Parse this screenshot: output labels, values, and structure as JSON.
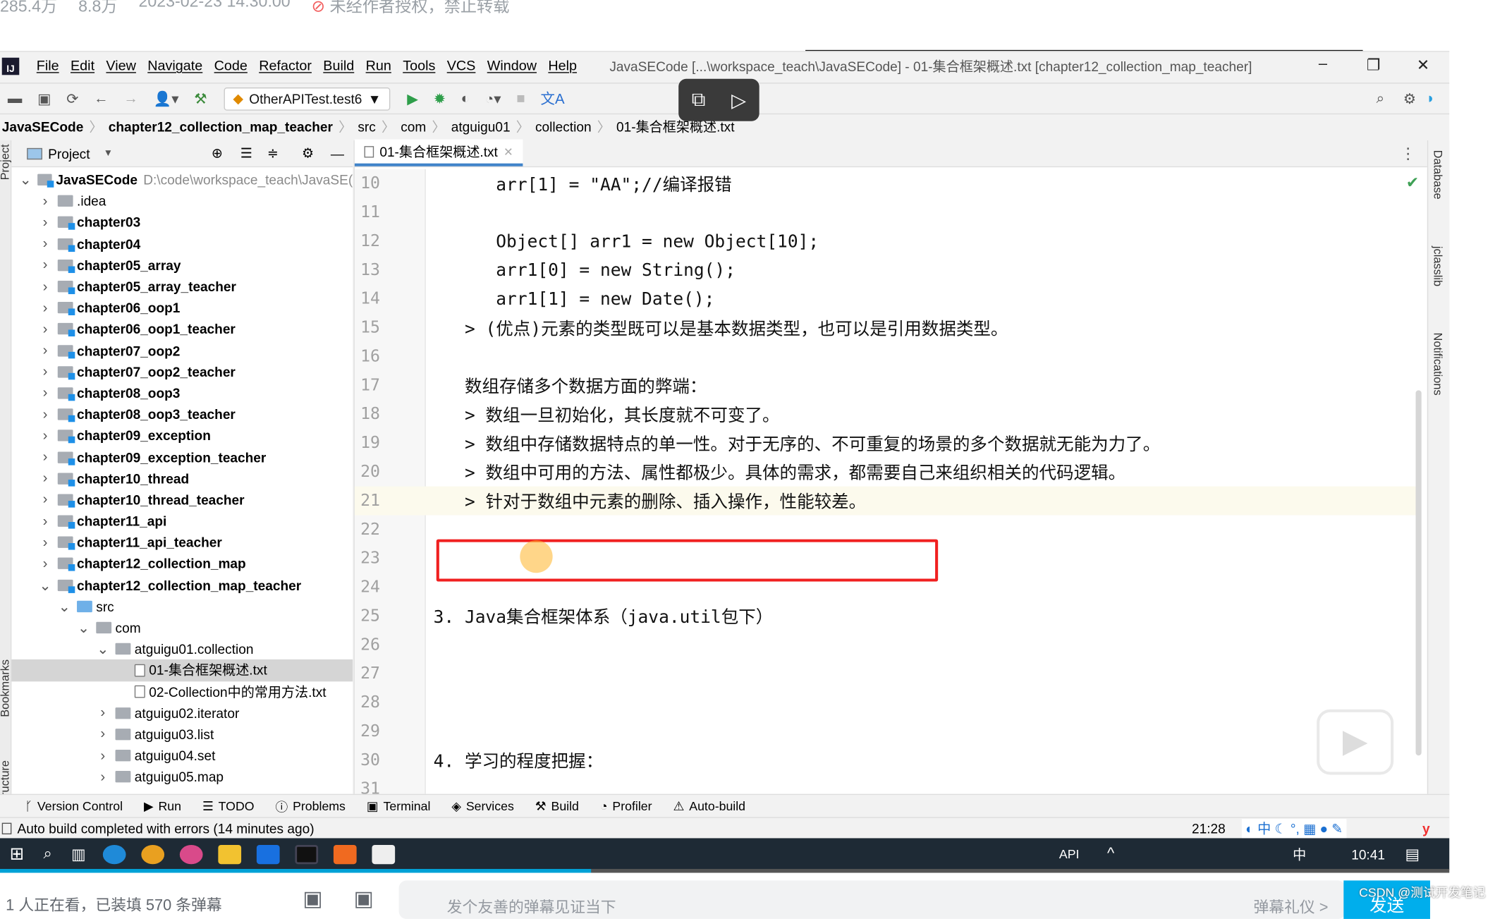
{
  "video_meta": {
    "plays": "285.4万",
    "danmaku": "8.8万",
    "datetime": "2023-02-23 14:30:00",
    "notice": "未经作者授权，禁止转载"
  },
  "menu": [
    "File",
    "Edit",
    "View",
    "Navigate",
    "Code",
    "Refactor",
    "Build",
    "Run",
    "Tools",
    "VCS",
    "Window",
    "Help"
  ],
  "window_title": "JavaSECode [...\\workspace_teach\\JavaSECode] - 01-集合框架概述.txt [chapter12_collection_map_teacher]",
  "toolbar": {
    "run_config": "OtherAPITest.test6"
  },
  "breadcrumb": [
    "JavaSECode",
    "chapter12_collection_map_teacher",
    "src",
    "com",
    "atguigu01",
    "collection",
    "01-集合框架概述.txt"
  ],
  "project_panel": {
    "title": "Project",
    "tree": [
      {
        "label": "JavaSECode",
        "path": "D:\\code\\workspace_teach\\JavaSE(",
        "level": 0,
        "type": "mod",
        "open": true,
        "bold": true
      },
      {
        "label": ".idea",
        "level": 1,
        "type": "folder",
        "open": false
      },
      {
        "label": "chapter03",
        "level": 1,
        "type": "mod",
        "open": false,
        "bold": true
      },
      {
        "label": "chapter04",
        "level": 1,
        "type": "mod",
        "open": false,
        "bold": true
      },
      {
        "label": "chapter05_array",
        "level": 1,
        "type": "mod",
        "open": false,
        "bold": true
      },
      {
        "label": "chapter05_array_teacher",
        "level": 1,
        "type": "mod",
        "open": false,
        "bold": true
      },
      {
        "label": "chapter06_oop1",
        "level": 1,
        "type": "mod",
        "open": false,
        "bold": true
      },
      {
        "label": "chapter06_oop1_teacher",
        "level": 1,
        "type": "mod",
        "open": false,
        "bold": true
      },
      {
        "label": "chapter07_oop2",
        "level": 1,
        "type": "mod",
        "open": false,
        "bold": true
      },
      {
        "label": "chapter07_oop2_teacher",
        "level": 1,
        "type": "mod",
        "open": false,
        "bold": true
      },
      {
        "label": "chapter08_oop3",
        "level": 1,
        "type": "mod",
        "open": false,
        "bold": true
      },
      {
        "label": "chapter08_oop3_teacher",
        "level": 1,
        "type": "mod",
        "open": false,
        "bold": true
      },
      {
        "label": "chapter09_exception",
        "level": 1,
        "type": "mod",
        "open": false,
        "bold": true
      },
      {
        "label": "chapter09_exception_teacher",
        "level": 1,
        "type": "mod",
        "open": false,
        "bold": true
      },
      {
        "label": "chapter10_thread",
        "level": 1,
        "type": "mod",
        "open": false,
        "bold": true
      },
      {
        "label": "chapter10_thread_teacher",
        "level": 1,
        "type": "mod",
        "open": false,
        "bold": true
      },
      {
        "label": "chapter11_api",
        "level": 1,
        "type": "mod",
        "open": false,
        "bold": true
      },
      {
        "label": "chapter11_api_teacher",
        "level": 1,
        "type": "mod",
        "open": false,
        "bold": true
      },
      {
        "label": "chapter12_collection_map",
        "level": 1,
        "type": "mod",
        "open": false,
        "bold": true
      },
      {
        "label": "chapter12_collection_map_teacher",
        "level": 1,
        "type": "mod",
        "open": true,
        "bold": true
      },
      {
        "label": "src",
        "level": 2,
        "type": "src",
        "open": true
      },
      {
        "label": "com",
        "level": 3,
        "type": "folder",
        "open": true
      },
      {
        "label": "atguigu01.collection",
        "level": 4,
        "type": "folder",
        "open": true
      },
      {
        "label": "01-集合框架概述.txt",
        "level": 5,
        "type": "file",
        "selected": true
      },
      {
        "label": "02-Collection中的常用方法.txt",
        "level": 5,
        "type": "file"
      },
      {
        "label": "atguigu02.iterator",
        "level": 4,
        "type": "folder",
        "open": false
      },
      {
        "label": "atguigu03.list",
        "level": 4,
        "type": "folder",
        "open": false
      },
      {
        "label": "atguigu04.set",
        "level": 4,
        "type": "folder",
        "open": false
      },
      {
        "label": "atguigu05.map",
        "level": 4,
        "type": "folder",
        "open": false
      }
    ]
  },
  "editor": {
    "tab": "01-集合框架概述.txt",
    "lines": [
      {
        "n": "10",
        "t": "      arr[1] = \"AA\";//编译报错"
      },
      {
        "n": "11",
        "t": ""
      },
      {
        "n": "12",
        "t": "      Object[] arr1 = new Object[10];"
      },
      {
        "n": "13",
        "t": "      arr1[0] = new String();"
      },
      {
        "n": "14",
        "t": "      arr1[1] = new Date();"
      },
      {
        "n": "15",
        "t": "   > (优点)元素的类型既可以是基本数据类型，也可以是引用数据类型。"
      },
      {
        "n": "16",
        "t": ""
      },
      {
        "n": "17",
        "t": "   数组存储多个数据方面的弊端："
      },
      {
        "n": "18",
        "t": "   > 数组一旦初始化，其长度就不可变了。"
      },
      {
        "n": "19",
        "t": "   > 数组中存储数据特点的单一性。对于无序的、不可重复的场景的多个数据就无能为力了。"
      },
      {
        "n": "20",
        "t": "   > 数组中可用的方法、属性都极少。具体的需求，都需要自己来组织相关的代码逻辑。"
      },
      {
        "n": "21",
        "t": "   > 针对于数组中元素的删除、插入操作，性能较差。",
        "current": true
      },
      {
        "n": "22",
        "t": ""
      },
      {
        "n": "23",
        "t": ""
      },
      {
        "n": "24",
        "t": ""
      },
      {
        "n": "25",
        "t": "3. Java集合框架体系（java.util包下）"
      },
      {
        "n": "26",
        "t": ""
      },
      {
        "n": "27",
        "t": ""
      },
      {
        "n": "28",
        "t": ""
      },
      {
        "n": "29",
        "t": ""
      },
      {
        "n": "30",
        "t": "4. 学习的程度把握："
      },
      {
        "n": "31",
        "t": ""
      }
    ]
  },
  "right_strip": [
    "Database",
    "jclasslib",
    "Notifications"
  ],
  "left_strip": [
    "Project",
    "Bookmarks",
    "Structure"
  ],
  "tool_windows": [
    "Version Control",
    "Run",
    "TODO",
    "Problems",
    "Terminal",
    "Services",
    "Build",
    "Profiler",
    "Auto-build"
  ],
  "status": {
    "message": "Auto build completed with errors (14 minutes ago)",
    "position": "21:28",
    "ime": "中"
  },
  "taskbar": {
    "tray_text": "API",
    "ime": "中",
    "clock": "10:41"
  },
  "player": {
    "progress_percent": 40.8,
    "viewers": "1 人正在看，已装填 570 条弹幕",
    "danmaku_placeholder": "发个友善的弹幕见证当下",
    "etiquette": "弹幕礼仪 >",
    "send": "发送",
    "watermark": "CSDN @测试开发笔记"
  },
  "colors": {
    "accent": "#00aeec",
    "highlight_box": "#f02020",
    "taskbar": "#1e2a35"
  }
}
